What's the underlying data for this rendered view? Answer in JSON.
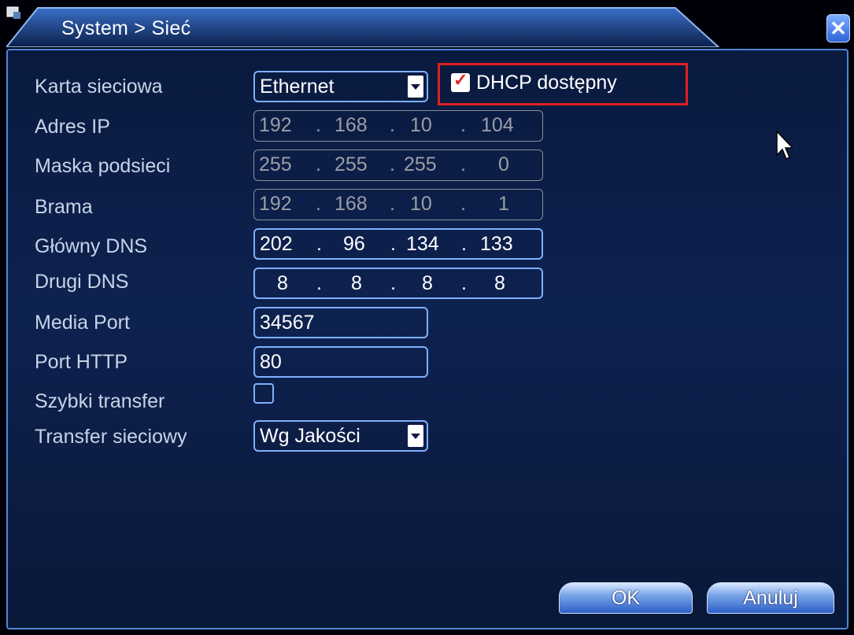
{
  "window": {
    "title": "System > Sieć"
  },
  "dhcp": {
    "label": "DHCP dostępny",
    "checked": true
  },
  "rows": {
    "nic": {
      "label": "Karta sieciowa",
      "value": "Ethernet"
    },
    "ip": {
      "label": "Adres IP",
      "octets": [
        "192",
        "168",
        "10",
        "104"
      ]
    },
    "mask": {
      "label": "Maska podsieci",
      "octets": [
        "255",
        "255",
        "255",
        "0"
      ]
    },
    "gateway": {
      "label": "Brama",
      "octets": [
        "192",
        "168",
        "10",
        "1"
      ]
    },
    "dns1": {
      "label": "Główny DNS",
      "octets": [
        "202",
        "96",
        "134",
        "133"
      ]
    },
    "dns2": {
      "label": "Drugi DNS",
      "octets": [
        "8",
        "8",
        "8",
        "8"
      ]
    },
    "media_port": {
      "label": "Media Port",
      "value": "34567"
    },
    "http_port": {
      "label": "Port HTTP",
      "value": "80"
    },
    "fast_transfer": {
      "label": "Szybki transfer",
      "checked": false
    },
    "net_transfer": {
      "label": "Transfer sieciowy",
      "value": "Wg Jakości"
    }
  },
  "buttons": {
    "ok": "OK",
    "cancel": "Anuluj"
  },
  "colors": {
    "background": "#0e2250",
    "accent": "#7fb0ff",
    "highlight": "#e02020"
  }
}
